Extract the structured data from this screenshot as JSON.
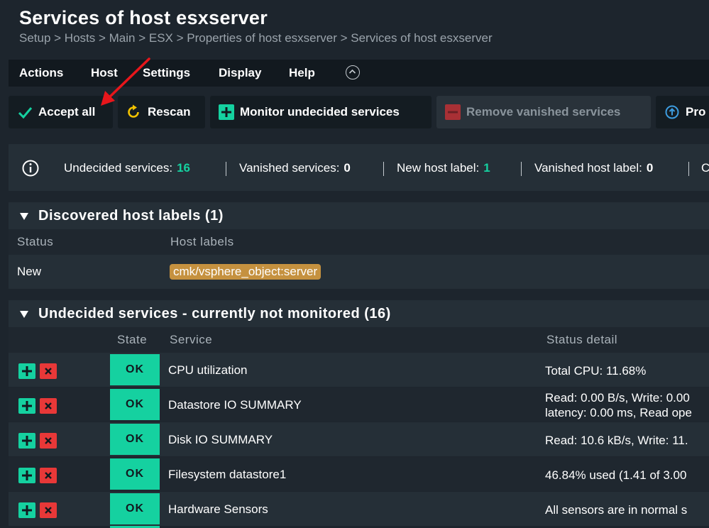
{
  "page": {
    "title": "Services of host esxserver",
    "breadcrumb": "Setup > Hosts > Main > ESX > Properties of host esxserver > Services of host esxserver"
  },
  "menu": {
    "items": [
      {
        "label": "Actions"
      },
      {
        "label": "Host"
      },
      {
        "label": "Settings"
      },
      {
        "label": "Display"
      },
      {
        "label": "Help"
      }
    ]
  },
  "toolbar": {
    "accept_all": "Accept all",
    "rescan": "Rescan",
    "monitor_undecided": "Monitor undecided services",
    "remove_vanished": "Remove vanished services",
    "more": "Pro"
  },
  "info": {
    "undecided_label": "Undecided services:",
    "undecided_value": "16",
    "vanished_label": "Vanished services:",
    "vanished_value": "0",
    "new_label_label": "New host label:",
    "new_label_value": "1",
    "vanished_label_label": "Vanished host label:",
    "vanished_label_value": "0",
    "more": "C"
  },
  "labels_panel": {
    "title": "Discovered host labels (1)",
    "col_status": "Status",
    "col_labels": "Host labels",
    "rows": [
      {
        "status": "New",
        "label": "cmk/vsphere_object:server"
      }
    ]
  },
  "services_panel": {
    "title": "Undecided services - currently not monitored (16)",
    "col_state": "State",
    "col_service": "Service",
    "col_detail": "Status detail",
    "rows": [
      {
        "state": "OK",
        "service": "CPU utilization",
        "detail": "Total CPU: 11.68%",
        "detail2": ""
      },
      {
        "state": "OK",
        "service": "Datastore IO SUMMARY",
        "detail": "Read: 0.00 B/s, Write: 0.00",
        "detail2": "latency: 0.00 ms, Read ope"
      },
      {
        "state": "OK",
        "service": "Disk IO SUMMARY",
        "detail": "Read: 10.6 kB/s, Write: 11.",
        "detail2": ""
      },
      {
        "state": "OK",
        "service": "Filesystem datastore1",
        "detail": "46.84% used (1.41 of 3.00",
        "detail2": ""
      },
      {
        "state": "OK",
        "service": "Hardware Sensors",
        "detail": "All sensors are in normal s",
        "detail2": ""
      }
    ]
  },
  "colors": {
    "ok": "#15d1a0",
    "remove": "#e83838",
    "label_badge": "#c5913f",
    "arrow": "#e8161b"
  },
  "icons": {
    "accept": "check-icon",
    "rescan": "refresh-icon",
    "monitor": "plus-icon",
    "remove": "minus-icon",
    "more": "arrow-up-circle-icon",
    "info": "info-icon",
    "add_service": "plus-icon",
    "remove_service": "close-icon"
  }
}
